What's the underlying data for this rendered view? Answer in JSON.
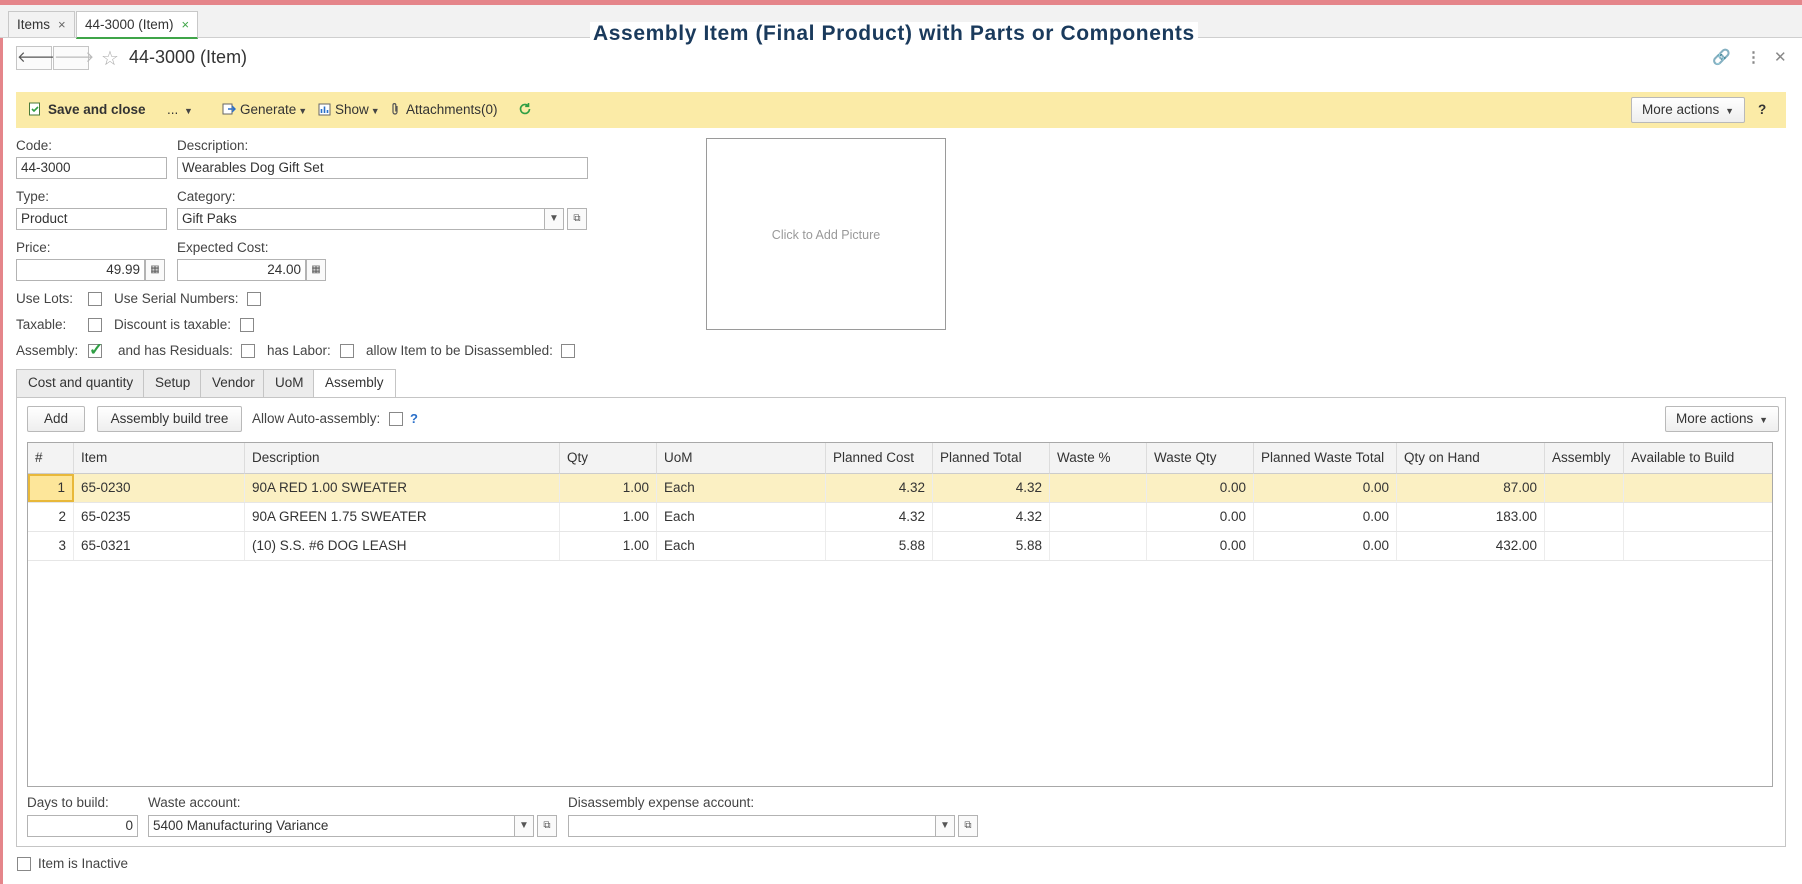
{
  "window_tabs": [
    {
      "label": "Items",
      "close": "×"
    },
    {
      "label": "44-3000 (Item)",
      "close": "×"
    }
  ],
  "overlay_title": "Assembly Item (Final Product) with Parts or Components",
  "form": {
    "title": "44-3000 (Item)",
    "back_glyph": "🡐",
    "forward_glyph": "🡒",
    "star_glyph": "☆",
    "link_glyph": "🔗",
    "menu_glyph": "⋮",
    "close_glyph": "✕"
  },
  "toolbar": {
    "save_close": "Save and close",
    "ellipsis": "...",
    "generate": "Generate",
    "show": "Show",
    "attachments": "Attachments(0)",
    "more_actions": "More actions",
    "help": "?"
  },
  "fields": {
    "code_label": "Code:",
    "code_value": "44-3000",
    "description_label": "Description:",
    "description_value": "Wearables Dog Gift Set",
    "type_label": "Type:",
    "type_value": "Product",
    "category_label": "Category:",
    "category_value": "Gift Paks",
    "price_label": "Price:",
    "price_value": "49.99",
    "expected_cost_label": "Expected Cost:",
    "expected_cost_value": "24.00",
    "use_lots_label": "Use Lots:",
    "use_serial_label": "Use Serial Numbers:",
    "taxable_label": "Taxable:",
    "discount_taxable_label": "Discount is taxable:",
    "assembly_label": "Assembly:",
    "residuals_label": "and has Residuals:",
    "labor_label": "has Labor:",
    "disassemble_label": "allow Item to be Disassembled:"
  },
  "checks": {
    "use_lots": false,
    "use_serial": false,
    "taxable": false,
    "discount_taxable": false,
    "assembly": true,
    "residuals": false,
    "labor": false,
    "disassemble": false,
    "auto_assembly": false,
    "inactive": false
  },
  "picture_placeholder": "Click to Add Picture",
  "tabs": [
    "Cost and quantity",
    "Setup",
    "Vendor",
    "UoM",
    "Assembly"
  ],
  "assembly": {
    "add_button": "Add",
    "build_tree_button": "Assembly build tree",
    "auto_assembly_label": "Allow Auto-assembly:",
    "help": "?",
    "more_actions": "More actions",
    "columns": [
      "#",
      "Item",
      "Description",
      "Qty",
      "UoM",
      "Planned Cost",
      "Planned Total",
      "Waste %",
      "Waste Qty",
      "Planned Waste Total",
      "Qty on Hand",
      "Assembly",
      "Available to Build"
    ],
    "rows": [
      {
        "n": "1",
        "item": "65-0230",
        "desc": "90A RED 1.00 SWEATER",
        "qty": "1.00",
        "uom": "Each",
        "pcost": "4.32",
        "ptotal": "4.32",
        "wpct": "",
        "wqty": "0.00",
        "pwtotal": "0.00",
        "onhand": "87.00",
        "asm": "",
        "avail": ""
      },
      {
        "n": "2",
        "item": "65-0235",
        "desc": "90A GREEN 1.75 SWEATER",
        "qty": "1.00",
        "uom": "Each",
        "pcost": "4.32",
        "ptotal": "4.32",
        "wpct": "",
        "wqty": "0.00",
        "pwtotal": "0.00",
        "onhand": "183.00",
        "asm": "",
        "avail": ""
      },
      {
        "n": "3",
        "item": "65-0321",
        "desc": "(10) S.S. #6 DOG LEASH",
        "qty": "1.00",
        "uom": "Each",
        "pcost": "5.88",
        "ptotal": "5.88",
        "wpct": "",
        "wqty": "0.00",
        "pwtotal": "0.00",
        "onhand": "432.00",
        "asm": "",
        "avail": ""
      }
    ],
    "days_label": "Days to build:",
    "days_value": "0",
    "waste_account_label": "Waste account:",
    "waste_account_value": "5400 Manufacturing Variance",
    "disassembly_label": "Disassembly expense account:",
    "disassembly_value": ""
  },
  "inactive_label": "Item is Inactive",
  "colors": {
    "accent_green": "#3fa548",
    "toolbar_bg": "#fbeba7",
    "selected_row": "#fbf0c3"
  }
}
